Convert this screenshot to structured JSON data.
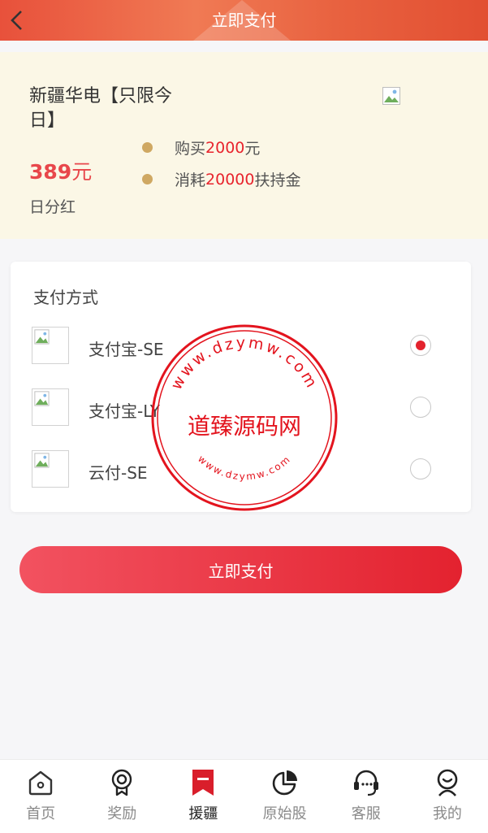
{
  "header": {
    "title": "立即支付",
    "back_icon": "chevron-left-icon"
  },
  "product": {
    "name": "新疆华电【只限今日】",
    "price": "389",
    "price_unit": "元",
    "period": "日分红",
    "image_icon": "broken-image-icon",
    "bullets": [
      {
        "prefix": "购买",
        "value": "2000",
        "suffix": "元"
      },
      {
        "prefix": "消耗",
        "value": "20000",
        "suffix": "扶持金"
      }
    ]
  },
  "payment": {
    "title": "支付方式",
    "methods": [
      {
        "label": "支付宝-SE",
        "selected": true
      },
      {
        "label": "支付宝-LY",
        "selected": false
      },
      {
        "label": "云付-SE",
        "selected": false
      }
    ]
  },
  "pay_button": "立即支付",
  "watermark": {
    "center": "道臻源码网",
    "ring_top": "www.dzymw.com",
    "ring_bottom": "www.dzymw.com"
  },
  "tabbar": [
    {
      "label": "首页",
      "icon": "home-icon",
      "active": false
    },
    {
      "label": "奖励",
      "icon": "award-icon",
      "active": false
    },
    {
      "label": "援疆",
      "icon": "bookmark-icon",
      "active": true
    },
    {
      "label": "原始股",
      "icon": "pie-chart-icon",
      "active": false
    },
    {
      "label": "客服",
      "icon": "headset-icon",
      "active": false
    },
    {
      "label": "我的",
      "icon": "user-icon",
      "active": false
    }
  ],
  "colors": {
    "accent": "#e3232d",
    "header": "#e8513b",
    "bullet": "#cfa862",
    "product_bg": "#fbf7e6"
  }
}
